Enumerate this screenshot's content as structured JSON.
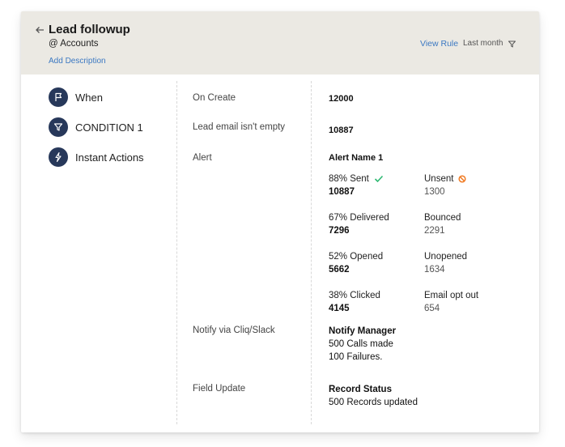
{
  "header": {
    "title": "Lead followup",
    "module": "@ Accounts",
    "add_description": "Add Description",
    "view_rule": "View Rule",
    "period": "Last month"
  },
  "steps": [
    {
      "label": "When",
      "icon": "flag-icon"
    },
    {
      "label": "CONDITION 1",
      "icon": "filter-icon"
    },
    {
      "label": "Instant Actions",
      "icon": "lightning-icon"
    }
  ],
  "rows": {
    "on_create": {
      "label": "On Create",
      "value": "12000"
    },
    "condition": {
      "label": "Lead email isn't empty",
      "value": "10887"
    },
    "alert": {
      "label": "Alert",
      "name": "Alert Name 1",
      "stats": {
        "sent": {
          "label": "88% Sent",
          "value": "10887"
        },
        "unsent": {
          "label": "Unsent",
          "value": "1300"
        },
        "delivered": {
          "label": "67% Delivered",
          "value": "7296"
        },
        "bounced": {
          "label": "Bounced",
          "value": "2291"
        },
        "opened": {
          "label": "52% Opened",
          "value": "5662"
        },
        "unopened": {
          "label": "Unopened",
          "value": "1634"
        },
        "clicked": {
          "label": "38% Clicked",
          "value": "4145"
        },
        "opt_out": {
          "label": "Email opt out",
          "value": "654"
        }
      }
    },
    "notify": {
      "label": "Notify via Cliq/Slack",
      "title": "Notify Manager",
      "line1": "500 Calls made",
      "line2": "100 Failures."
    },
    "field_update": {
      "label": "Field Update",
      "title": "Record Status",
      "line1": "500 Records updated"
    }
  },
  "colors": {
    "accent": "#3b78c2",
    "icon_bg": "#27385a",
    "header_bg": "#ebe9e3",
    "success": "#2eb872",
    "warning": "#f07a22"
  }
}
